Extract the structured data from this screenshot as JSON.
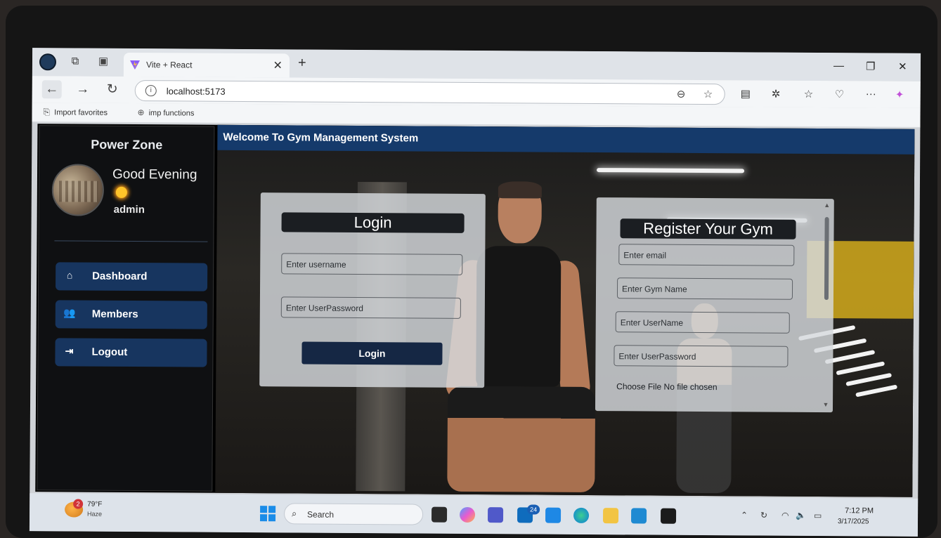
{
  "browser": {
    "tab_title": "Vite + React",
    "url": "localhost:5173",
    "favorites": [
      {
        "label": "Import favorites"
      },
      {
        "label": "imp functions"
      }
    ]
  },
  "sidebar": {
    "brand": "Power Zone",
    "greeting": "Good Evening",
    "username": "admin",
    "nav": [
      {
        "label": "Dashboard",
        "icon": "home-icon"
      },
      {
        "label": "Members",
        "icon": "users-icon"
      },
      {
        "label": "Logout",
        "icon": "logout-icon"
      }
    ]
  },
  "header": {
    "title": "Welcome To Gym Management System"
  },
  "login_form": {
    "title": "Login",
    "username_placeholder": "Enter username",
    "password_placeholder": "Enter UserPassword",
    "button_label": "Login"
  },
  "register_form": {
    "title": "Register Your Gym",
    "email_placeholder": "Enter email",
    "gym_name_placeholder": "Enter Gym Name",
    "username_placeholder": "Enter UserName",
    "password_placeholder": "Enter UserPassword",
    "file_label": "Choose File No file chosen"
  },
  "taskbar": {
    "weather_badge": "2",
    "weather_temp": "79°F",
    "weather_condition": "Haze",
    "search_label": "Search",
    "mail_badge": "24",
    "time": "7:12 PM",
    "date": "3/17/2025"
  },
  "colors": {
    "header_bg": "#153a6b",
    "nav_item_bg": "#17355f",
    "login_button_bg": "#152744"
  }
}
